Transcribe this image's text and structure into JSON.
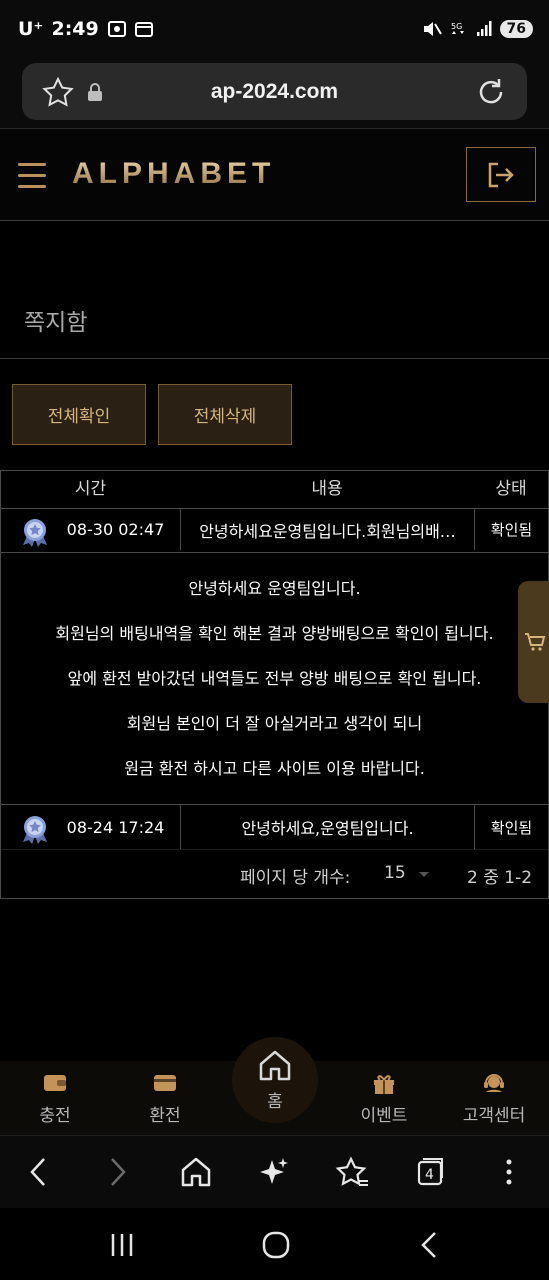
{
  "status_bar": {
    "carrier": "U⁺",
    "time": "2:49",
    "battery": "76"
  },
  "browser": {
    "url": "ap-2024.com"
  },
  "site": {
    "logo": "ALPHABET"
  },
  "page": {
    "title": "쪽지함",
    "confirm_all": "전체확인",
    "delete_all": "전체삭제"
  },
  "table": {
    "headers": {
      "time": "시간",
      "content": "내용",
      "status": "상태"
    },
    "rows": [
      {
        "time": "08-30 02:47",
        "content": "안녕하세요운영팀입니다.회원님의배…",
        "status": "확인됨"
      },
      {
        "time": "08-24 17:24",
        "content": "안녕하세요,운영팀입니다.",
        "status": "확인됨"
      }
    ],
    "detail_lines": [
      "안녕하세요 운영팀입니다.",
      "회원님의 배팅내역을 확인 해본 결과 양방배팅으로 확인이 됩니다.",
      "앞에 환전 받아갔던 내역들도 전부 양방 배팅으로 확인 됩니다.",
      "회원님 본인이 더 잘 아실거라고 생각이 되니",
      "원금 환전 하시고 다른 사이트 이용 바랍니다."
    ],
    "pagination": {
      "per_page_label": "페이지 당 개수:",
      "per_page_value": "15",
      "range": "2 중 1-2"
    }
  },
  "bottom_nav": {
    "deposit": "충전",
    "withdraw": "환전",
    "home": "홈",
    "event": "이벤트",
    "support": "고객센터"
  },
  "colors": {
    "gold": "#c9a36d",
    "button_bg": "#2a2014",
    "border": "#4a4a4a"
  }
}
